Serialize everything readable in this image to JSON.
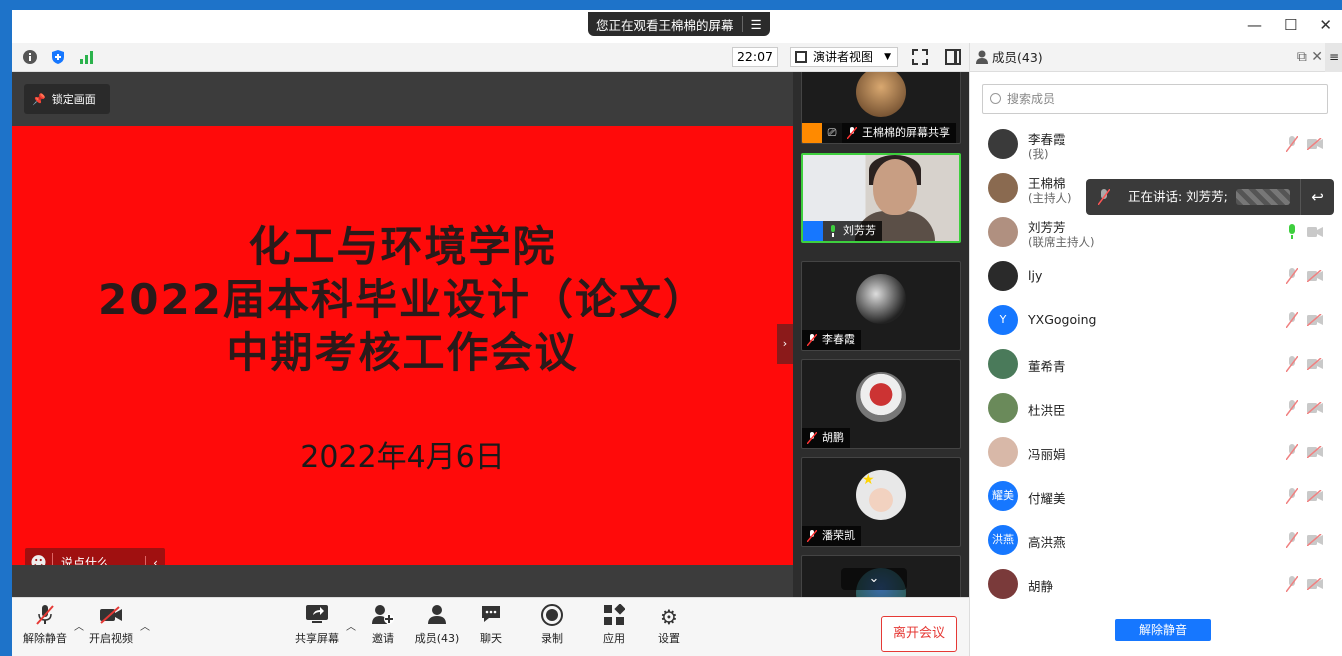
{
  "titlebar": {
    "sharing_notice": "您正在观看王棉棉的屏幕"
  },
  "topbar": {
    "clock": "22:07",
    "view_label": "演讲者视图"
  },
  "stage": {
    "lock_label": "锁定画面",
    "slide_lines": [
      "化工与环境学院",
      "2022届本科毕业设计（论文）",
      "中期考核工作会议"
    ],
    "slide_date": "2022年4月6日",
    "chat_placeholder": "说点什么..."
  },
  "strip": {
    "tiles": [
      {
        "name": "王棉棉的屏幕共享"
      },
      {
        "name": "刘芳芳"
      },
      {
        "name": "李春霞"
      },
      {
        "name": "胡鹏"
      },
      {
        "name": "潘荣凯"
      }
    ]
  },
  "bottombar": {
    "unmute": "解除静音",
    "start_video": "开启视频",
    "share_screen": "共享屏幕",
    "invite": "邀请",
    "members": "成员(43)",
    "chat": "聊天",
    "record": "录制",
    "apps": "应用",
    "settings": "设置",
    "leave": "离开会议"
  },
  "panel": {
    "title": "成员(43)",
    "search_placeholder": "搜索成员",
    "speaking_tip": "正在讲话: 刘芳芳;",
    "unmute_all": "解除静音",
    "members": [
      {
        "name": "李春霞",
        "role": "(我)",
        "avatar_color": "#3a3a3a",
        "mic": "muted"
      },
      {
        "name": "王棉棉",
        "role": "(主持人)",
        "avatar_color": "#8a6a50",
        "mic": "muted"
      },
      {
        "name": "刘芳芳",
        "role": "(联席主持人)",
        "avatar_color": "#b09080",
        "mic": "active"
      },
      {
        "name": "ljy",
        "role": "",
        "avatar_color": "#2a2a2a",
        "mic": "muted"
      },
      {
        "name": "YXGogoing",
        "role": "",
        "avatar_color": "#1677ff",
        "avatar_text": "Y",
        "mic": "muted"
      },
      {
        "name": "董希青",
        "role": "",
        "avatar_color": "#4a7a5a",
        "mic": "muted"
      },
      {
        "name": "杜洪臣",
        "role": "",
        "avatar_color": "#6a8a5a",
        "mic": "muted"
      },
      {
        "name": "冯丽娟",
        "role": "",
        "avatar_color": "#d8b8a8",
        "mic": "muted"
      },
      {
        "name": "付耀美",
        "role": "",
        "avatar_color": "#1677ff",
        "avatar_text": "耀美",
        "mic": "muted"
      },
      {
        "name": "高洪燕",
        "role": "",
        "avatar_color": "#1677ff",
        "avatar_text": "洪燕",
        "mic": "muted"
      },
      {
        "name": "胡静",
        "role": "",
        "avatar_color": "#7a3a3a",
        "mic": "muted"
      }
    ]
  },
  "colors": {
    "slide_bg": "#ff0a0a",
    "accent": "#1677ff",
    "danger": "#e53935",
    "active_border": "#3ecf3e"
  }
}
